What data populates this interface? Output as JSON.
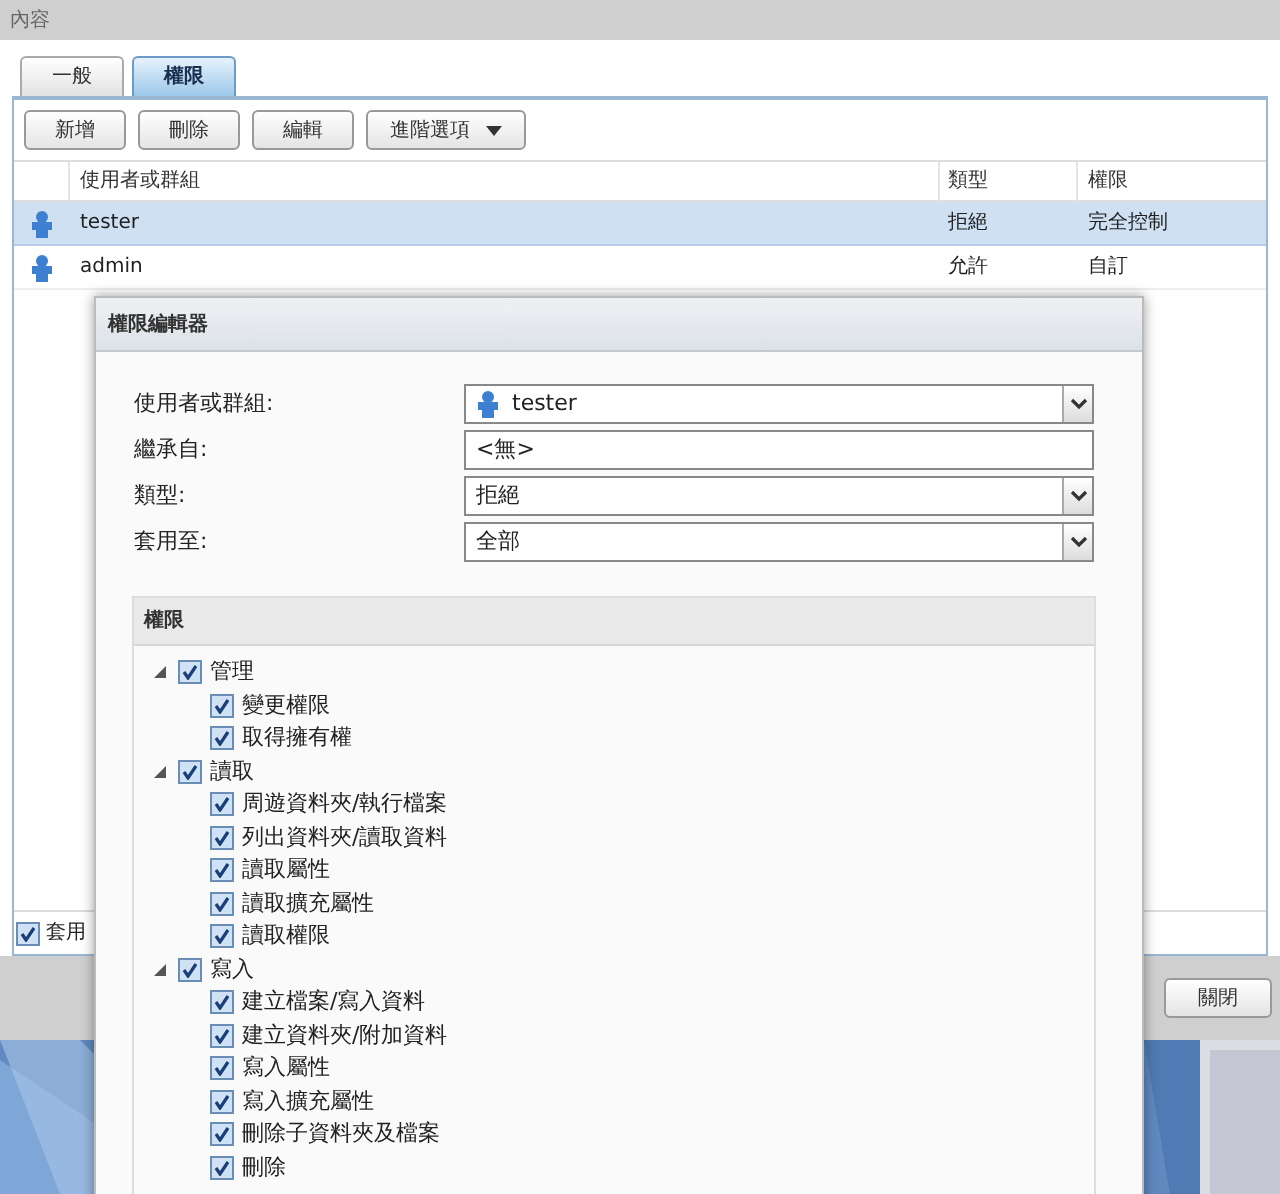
{
  "window": {
    "title": "內容"
  },
  "tabs": [
    {
      "label": "一般",
      "selected": false
    },
    {
      "label": "權限",
      "selected": true
    }
  ],
  "toolbar": [
    {
      "label": "新增",
      "kind": "plain"
    },
    {
      "label": "刪除",
      "kind": "plain"
    },
    {
      "label": "編輯",
      "kind": "plain"
    },
    {
      "label": "進階選項",
      "kind": "dropdown"
    }
  ],
  "table": {
    "columns": [
      "使用者或群組",
      "類型",
      "權限"
    ],
    "rows": [
      {
        "name": "tester",
        "type": "拒絕",
        "permission": "完全控制",
        "selected": true
      },
      {
        "name": "admin",
        "type": "允許",
        "permission": "自訂",
        "selected": false
      }
    ]
  },
  "apply_checkbox": {
    "label": "套用",
    "checked": true
  },
  "footer": {
    "buttons": [
      "關閉"
    ]
  },
  "editor": {
    "title": "權限編輯器",
    "fields": [
      {
        "label": "使用者或群組:",
        "value": "tester",
        "kind": "user-select"
      },
      {
        "label": "繼承自:",
        "value": "<無>",
        "kind": "text"
      },
      {
        "label": "類型:",
        "value": "拒絕",
        "kind": "select"
      },
      {
        "label": "套用至:",
        "value": "全部",
        "kind": "select"
      }
    ],
    "permissions": {
      "title": "權限",
      "tree": [
        {
          "label": "管理",
          "checked": true,
          "expanded": true,
          "children": [
            {
              "label": "變更權限",
              "checked": true
            },
            {
              "label": "取得擁有權",
              "checked": true
            }
          ]
        },
        {
          "label": "讀取",
          "checked": true,
          "expanded": true,
          "children": [
            {
              "label": "周遊資料夾/執行檔案",
              "checked": true
            },
            {
              "label": "列出資料夾/讀取資料",
              "checked": true
            },
            {
              "label": "讀取屬性",
              "checked": true
            },
            {
              "label": "讀取擴充屬性",
              "checked": true
            },
            {
              "label": "讀取權限",
              "checked": true
            }
          ]
        },
        {
          "label": "寫入",
          "checked": true,
          "expanded": true,
          "children": [
            {
              "label": "建立檔案/寫入資料",
              "checked": true
            },
            {
              "label": "建立資料夾/附加資料",
              "checked": true
            },
            {
              "label": "寫入屬性",
              "checked": true
            },
            {
              "label": "寫入擴充屬性",
              "checked": true
            },
            {
              "label": "刪除子資料夾及檔案",
              "checked": true
            },
            {
              "label": "刪除",
              "checked": true
            }
          ]
        }
      ]
    }
  }
}
